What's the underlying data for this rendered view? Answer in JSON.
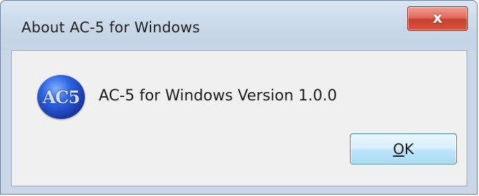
{
  "window": {
    "title": "About AC-5 for Windows",
    "close_label": "x"
  },
  "content": {
    "logo_text": "AC5",
    "version_text": "AC-5 for Windows Version 1.0.0"
  },
  "buttons": {
    "ok_mnemonic": "O",
    "ok_rest": "K"
  },
  "colors": {
    "titlebar": "#c8d6e7",
    "client_background": "#f0f0f0",
    "close_button": "#d9553f",
    "ok_button_border": "#3c7fb1",
    "logo": "#2f63e0"
  },
  "icons": {
    "close": "close-icon",
    "logo": "ac5-logo-icon"
  }
}
